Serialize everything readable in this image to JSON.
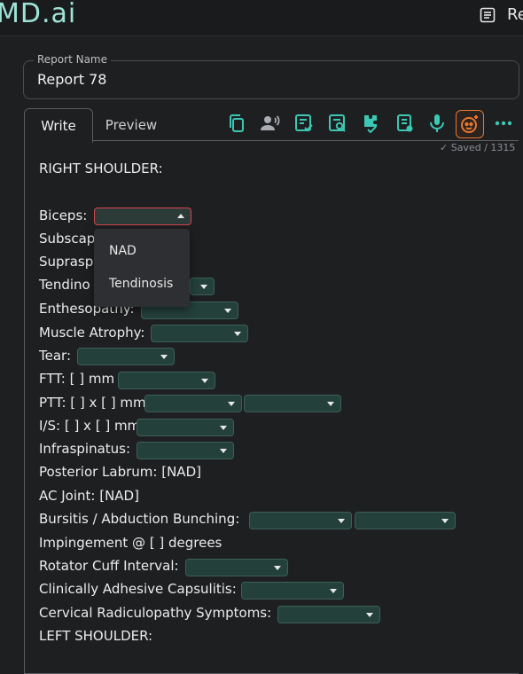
{
  "app": {
    "logo_text": "MD.ai",
    "header_label": "Re"
  },
  "report_name": {
    "label": "Report Name",
    "value": "Report 78"
  },
  "tabs": [
    {
      "label": "Write"
    },
    {
      "label": "Preview"
    }
  ],
  "toolbar_icons": [
    "copy-icon",
    "voice-profile-icon",
    "checklist-icon",
    "search-document-icon",
    "puzzle-check-icon",
    "document-settings-icon",
    "microphone-icon",
    "ai-assistant-icon",
    "more-icon"
  ],
  "status": {
    "saved_text": "✓ Saved / 1315"
  },
  "colors": {
    "accent": "#3cc8b4",
    "ai_border": "#e8762b",
    "dropdown_bg": "#24403b",
    "open_border": "#d64550"
  },
  "report": {
    "heading": "RIGHT SHOULDER:",
    "lines": [
      {
        "text": "Biceps:"
      },
      {
        "text": "Subscap"
      },
      {
        "text": "Suprasp"
      },
      {
        "text": "Tendino"
      },
      {
        "text": "Enthesopathy:"
      },
      {
        "text": "Muscle Atrophy:"
      },
      {
        "text": "Tear:"
      },
      {
        "text": "FTT: [ ] mm"
      },
      {
        "text": "PTT: [ ] x [ ] mm"
      },
      {
        "text": "I/S: [ ] x [ ] mm"
      },
      {
        "text": "Infraspinatus:"
      },
      {
        "text": "Posterior Labrum: [NAD]"
      },
      {
        "text": "AC Joint: [NAD]"
      },
      {
        "text": "Bursitis / Abduction Bunching:"
      },
      {
        "text": "Impingement @ [ ] degrees"
      },
      {
        "text": "Rotator Cuff Interval:"
      },
      {
        "text": "Clinically Adhesive Capsulitis:"
      },
      {
        "text": "Cervical Radiculopathy Symptoms:"
      },
      {
        "text": "LEFT SHOULDER:"
      }
    ]
  },
  "dropdown_menu": {
    "options": [
      "NAD",
      "Tendinosis"
    ]
  }
}
